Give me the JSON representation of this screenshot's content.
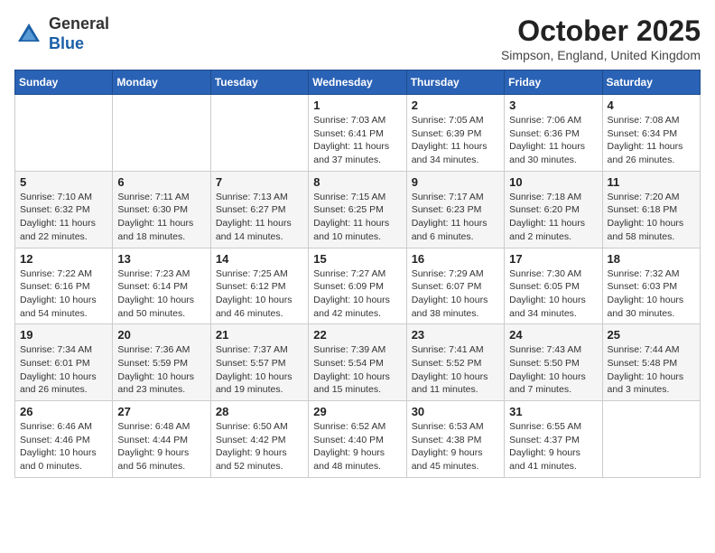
{
  "header": {
    "logo_general": "General",
    "logo_blue": "Blue",
    "month_year": "October 2025",
    "location": "Simpson, England, United Kingdom"
  },
  "weekdays": [
    "Sunday",
    "Monday",
    "Tuesday",
    "Wednesday",
    "Thursday",
    "Friday",
    "Saturday"
  ],
  "weeks": [
    [
      {
        "day": "",
        "info": ""
      },
      {
        "day": "",
        "info": ""
      },
      {
        "day": "",
        "info": ""
      },
      {
        "day": "1",
        "info": "Sunrise: 7:03 AM\nSunset: 6:41 PM\nDaylight: 11 hours\nand 37 minutes."
      },
      {
        "day": "2",
        "info": "Sunrise: 7:05 AM\nSunset: 6:39 PM\nDaylight: 11 hours\nand 34 minutes."
      },
      {
        "day": "3",
        "info": "Sunrise: 7:06 AM\nSunset: 6:36 PM\nDaylight: 11 hours\nand 30 minutes."
      },
      {
        "day": "4",
        "info": "Sunrise: 7:08 AM\nSunset: 6:34 PM\nDaylight: 11 hours\nand 26 minutes."
      }
    ],
    [
      {
        "day": "5",
        "info": "Sunrise: 7:10 AM\nSunset: 6:32 PM\nDaylight: 11 hours\nand 22 minutes."
      },
      {
        "day": "6",
        "info": "Sunrise: 7:11 AM\nSunset: 6:30 PM\nDaylight: 11 hours\nand 18 minutes."
      },
      {
        "day": "7",
        "info": "Sunrise: 7:13 AM\nSunset: 6:27 PM\nDaylight: 11 hours\nand 14 minutes."
      },
      {
        "day": "8",
        "info": "Sunrise: 7:15 AM\nSunset: 6:25 PM\nDaylight: 11 hours\nand 10 minutes."
      },
      {
        "day": "9",
        "info": "Sunrise: 7:17 AM\nSunset: 6:23 PM\nDaylight: 11 hours\nand 6 minutes."
      },
      {
        "day": "10",
        "info": "Sunrise: 7:18 AM\nSunset: 6:20 PM\nDaylight: 11 hours\nand 2 minutes."
      },
      {
        "day": "11",
        "info": "Sunrise: 7:20 AM\nSunset: 6:18 PM\nDaylight: 10 hours\nand 58 minutes."
      }
    ],
    [
      {
        "day": "12",
        "info": "Sunrise: 7:22 AM\nSunset: 6:16 PM\nDaylight: 10 hours\nand 54 minutes."
      },
      {
        "day": "13",
        "info": "Sunrise: 7:23 AM\nSunset: 6:14 PM\nDaylight: 10 hours\nand 50 minutes."
      },
      {
        "day": "14",
        "info": "Sunrise: 7:25 AM\nSunset: 6:12 PM\nDaylight: 10 hours\nand 46 minutes."
      },
      {
        "day": "15",
        "info": "Sunrise: 7:27 AM\nSunset: 6:09 PM\nDaylight: 10 hours\nand 42 minutes."
      },
      {
        "day": "16",
        "info": "Sunrise: 7:29 AM\nSunset: 6:07 PM\nDaylight: 10 hours\nand 38 minutes."
      },
      {
        "day": "17",
        "info": "Sunrise: 7:30 AM\nSunset: 6:05 PM\nDaylight: 10 hours\nand 34 minutes."
      },
      {
        "day": "18",
        "info": "Sunrise: 7:32 AM\nSunset: 6:03 PM\nDaylight: 10 hours\nand 30 minutes."
      }
    ],
    [
      {
        "day": "19",
        "info": "Sunrise: 7:34 AM\nSunset: 6:01 PM\nDaylight: 10 hours\nand 26 minutes."
      },
      {
        "day": "20",
        "info": "Sunrise: 7:36 AM\nSunset: 5:59 PM\nDaylight: 10 hours\nand 23 minutes."
      },
      {
        "day": "21",
        "info": "Sunrise: 7:37 AM\nSunset: 5:57 PM\nDaylight: 10 hours\nand 19 minutes."
      },
      {
        "day": "22",
        "info": "Sunrise: 7:39 AM\nSunset: 5:54 PM\nDaylight: 10 hours\nand 15 minutes."
      },
      {
        "day": "23",
        "info": "Sunrise: 7:41 AM\nSunset: 5:52 PM\nDaylight: 10 hours\nand 11 minutes."
      },
      {
        "day": "24",
        "info": "Sunrise: 7:43 AM\nSunset: 5:50 PM\nDaylight: 10 hours\nand 7 minutes."
      },
      {
        "day": "25",
        "info": "Sunrise: 7:44 AM\nSunset: 5:48 PM\nDaylight: 10 hours\nand 3 minutes."
      }
    ],
    [
      {
        "day": "26",
        "info": "Sunrise: 6:46 AM\nSunset: 4:46 PM\nDaylight: 10 hours\nand 0 minutes."
      },
      {
        "day": "27",
        "info": "Sunrise: 6:48 AM\nSunset: 4:44 PM\nDaylight: 9 hours\nand 56 minutes."
      },
      {
        "day": "28",
        "info": "Sunrise: 6:50 AM\nSunset: 4:42 PM\nDaylight: 9 hours\nand 52 minutes."
      },
      {
        "day": "29",
        "info": "Sunrise: 6:52 AM\nSunset: 4:40 PM\nDaylight: 9 hours\nand 48 minutes."
      },
      {
        "day": "30",
        "info": "Sunrise: 6:53 AM\nSunset: 4:38 PM\nDaylight: 9 hours\nand 45 minutes."
      },
      {
        "day": "31",
        "info": "Sunrise: 6:55 AM\nSunset: 4:37 PM\nDaylight: 9 hours\nand 41 minutes."
      },
      {
        "day": "",
        "info": ""
      }
    ]
  ]
}
